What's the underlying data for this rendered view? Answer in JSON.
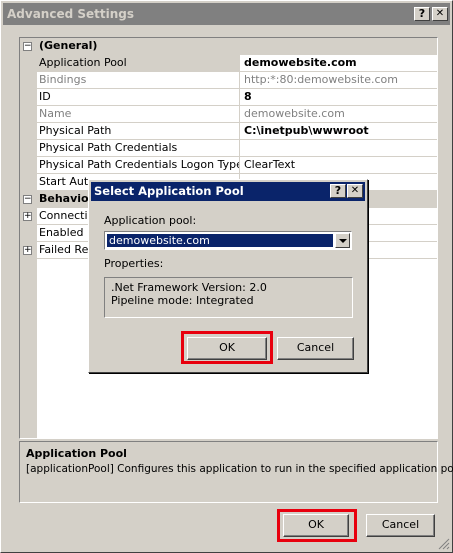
{
  "main_window": {
    "title": "Advanced Settings",
    "help_glyph": "?",
    "close_glyph": "✕",
    "ok_label": "OK",
    "cancel_label": "Cancel"
  },
  "property_grid": {
    "sections": [
      {
        "name": "(General)",
        "expanded": true,
        "toggle": "⊟",
        "properties": [
          {
            "name": "Application Pool",
            "value": "demowebsite.com",
            "bold": true,
            "readonly": false
          },
          {
            "name": "Bindings",
            "value": "http:*:80:demowebsite.com",
            "bold": false,
            "readonly": true
          },
          {
            "name": "ID",
            "value": "8",
            "bold": true,
            "readonly": false
          },
          {
            "name": "Name",
            "value": "demowebsite.com",
            "bold": false,
            "readonly": true
          },
          {
            "name": "Physical Path",
            "value": "C:\\inetpub\\wwwroot",
            "bold": true,
            "readonly": false
          },
          {
            "name": "Physical Path Credentials",
            "value": "",
            "bold": false,
            "readonly": false
          },
          {
            "name": "Physical Path Credentials Logon Type",
            "value": "ClearText",
            "bold": false,
            "readonly": false
          },
          {
            "name": "Start Auto",
            "value": "",
            "bold": false,
            "readonly": false
          }
        ]
      },
      {
        "name": "Behavior",
        "expanded": true,
        "toggle": "⊟",
        "properties": [
          {
            "name": "Connection",
            "value": "",
            "toggle": "+"
          },
          {
            "name": "Enabled Pr",
            "value": ""
          },
          {
            "name": "Failed Req",
            "value": "",
            "toggle": "+"
          }
        ]
      }
    ]
  },
  "description": {
    "title": "Application Pool",
    "text": "[applicationPool] Configures this application to run in the specified application pool."
  },
  "dialog": {
    "title": "Select Application Pool",
    "help_glyph": "?",
    "close_glyph": "✕",
    "pool_label": "Application pool:",
    "pool_selected": "demowebsite.com",
    "properties_label": "Properties:",
    "properties_lines": [
      ".Net Framework Version: 2.0",
      "Pipeline mode: Integrated"
    ],
    "ok_label": "OK",
    "cancel_label": "Cancel"
  },
  "colors": {
    "dialog_title_bg": "#0a246a",
    "inactive_title_bg": "#808080",
    "face": "#d4d0c8",
    "highlight_box": "#e8000e"
  }
}
